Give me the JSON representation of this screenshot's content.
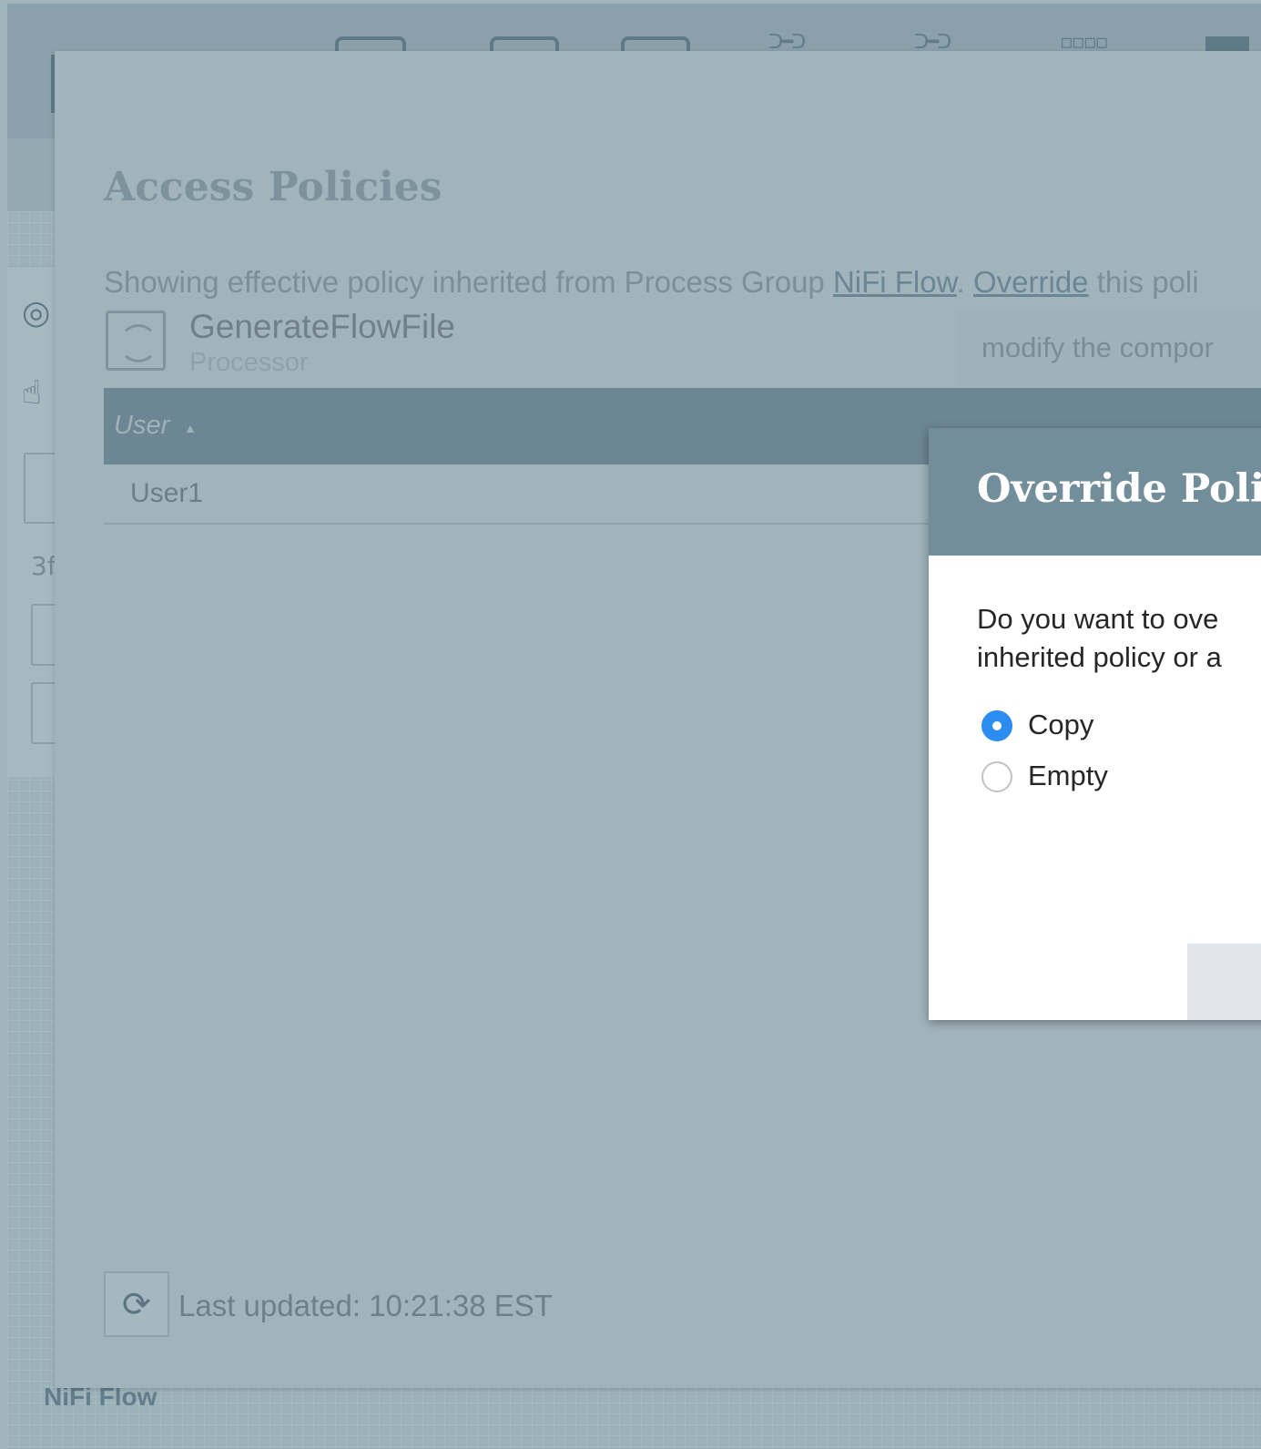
{
  "background": {
    "breadcrumb": "NiFi Flow",
    "left_panel_text": "3f"
  },
  "modal": {
    "title": "Access Policies",
    "message": {
      "prefix": "Showing effective policy inherited from Process Group ",
      "group_link": "NiFi Flow",
      "separator": ". ",
      "override_link": "Override",
      "suffix": " this poli"
    },
    "component": {
      "name": "GenerateFlowFile",
      "type": "Processor",
      "icon": "processor-icon"
    },
    "action_select": "modify the compor",
    "table": {
      "columns": [
        "User"
      ],
      "sort_icon": "sort-ascending-icon",
      "rows": [
        "User1"
      ]
    },
    "refresh_icon": "refresh-icon",
    "last_updated": "Last updated: 10:21:38 EST"
  },
  "dialog": {
    "title": "Override Poli",
    "question_line1": "Do you want to ove",
    "question_line2": "inherited policy or a",
    "options": [
      {
        "label": "Copy",
        "selected": true
      },
      {
        "label": "Empty",
        "selected": false
      }
    ]
  },
  "colors": {
    "overlay": "#a2b5bd",
    "header": "#6c8693",
    "dialog_header": "#728e9b",
    "radio_selected": "#2b8cf2"
  }
}
